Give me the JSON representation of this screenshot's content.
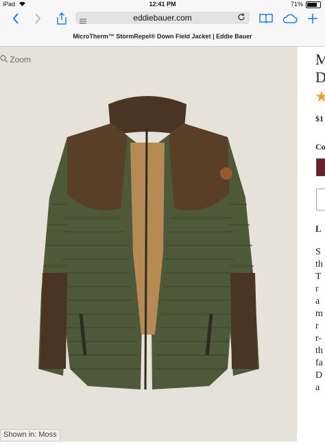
{
  "status_bar": {
    "carrier": "iPad",
    "time": "12:41 PM",
    "battery": "71%",
    "battery_level": 0.71
  },
  "browser": {
    "url": "eddiebauer.com",
    "page_title": "MicroTherm™ StormRepel® Down Field Jacket | Eddie Bauer"
  },
  "product": {
    "zoom_label": "Zoom",
    "shown_in": "Shown in: Moss",
    "right_column_fragments": [
      "M",
      "D",
      "$1",
      "Co",
      "L",
      "S",
      "th",
      "T",
      "r",
      "a",
      "m",
      "r",
      "r-",
      "th",
      "fa",
      "D",
      "a"
    ],
    "swatch_color": "#6e1f2c",
    "star_color": "#f0a020"
  },
  "icons": {
    "back": "chevron-left-icon",
    "forward": "chevron-right-icon",
    "share": "share-icon",
    "bookmarks": "book-icon",
    "cloud": "cloud-icon",
    "new_tab": "plus-icon",
    "reload": "reload-icon",
    "reader": "reader-menu-icon"
  }
}
